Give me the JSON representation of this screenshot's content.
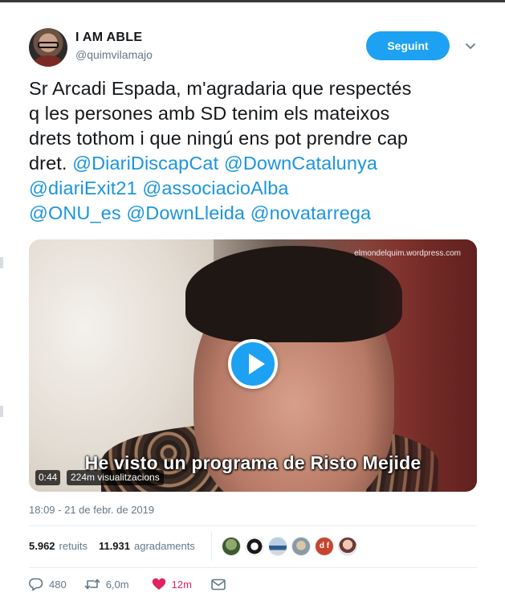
{
  "user": {
    "display_name": "I AM ABLE",
    "handle": "@quimvilamajo",
    "follow_label": "Seguint"
  },
  "tweet": {
    "text_lines": [
      "Sr Arcadi Espada, m'agradaria que respectés",
      "q les persones amb SD tenim els mateixos",
      "drets tothom i que ningú ens pot prendre cap"
    ],
    "line4_prefix": "dret. ",
    "mentions": [
      "@DiariDiscapCat",
      "@DownCatalunya",
      "@diariExit21",
      "@associacioAlba",
      "@ONU_es",
      "@DownLleida",
      "@novatarrega"
    ]
  },
  "video": {
    "watermark": "elmondelquim.wordpress.com",
    "subtitle": "He visto un programa de Risto Mejide",
    "duration": "0:44",
    "views": "224m visualitzacions"
  },
  "meta": {
    "timestamp": "18:09 - 21 de febr. de 2019",
    "retweets_count": "5.962",
    "retweets_label": "retuits",
    "likes_count": "11.931",
    "likes_label": "agradaments"
  },
  "likers": [
    "liker-avatar",
    "liker-avatar",
    "liker-avatar",
    "liker-avatar",
    "liker-avatar",
    "liker-avatar"
  ],
  "liker_initials": "d f",
  "actions": {
    "reply_count": "480",
    "retweet_count": "6,0m",
    "like_count": "12m"
  },
  "colors": {
    "accent": "#1da1f2",
    "mention": "#1b95e0",
    "like": "#e0245e",
    "muted": "#657786"
  }
}
